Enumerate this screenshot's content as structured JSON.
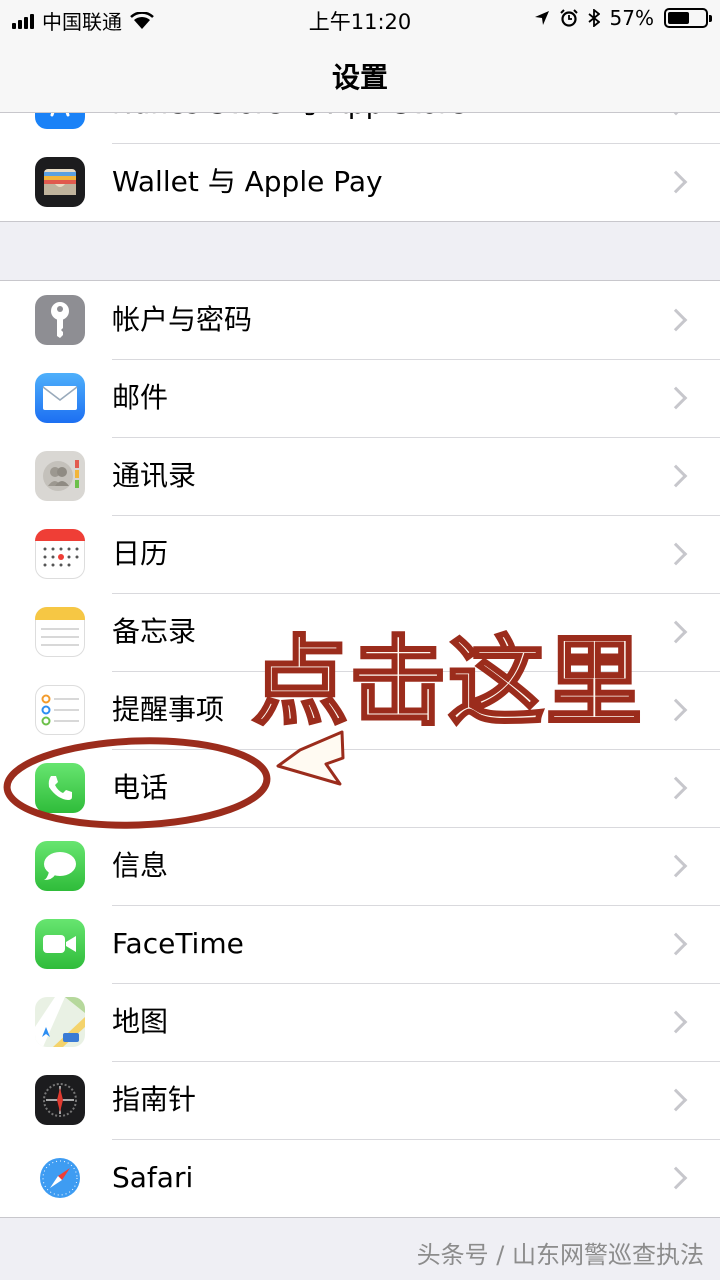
{
  "status_bar": {
    "carrier": "中国联通",
    "time": "上午11:20",
    "battery_percent": "57%",
    "battery_level": 0.57,
    "icons": [
      "signal-icon",
      "wifi-icon",
      "location-icon",
      "alarm-icon",
      "bluetooth-icon",
      "battery-icon"
    ]
  },
  "nav": {
    "title": "设置"
  },
  "groups": [
    {
      "items": [
        {
          "label": "iTunes Store 与 App Store",
          "icon": "app-store-icon",
          "color": "#1a82f7"
        },
        {
          "label": "Wallet 与 Apple Pay",
          "icon": "wallet-icon",
          "color": "#1c1c1e"
        }
      ]
    },
    {
      "items": [
        {
          "label": "帐户与密码",
          "icon": "key-icon",
          "color": "#8e8e93"
        },
        {
          "label": "邮件",
          "icon": "mail-icon",
          "color": "#2d8ef2"
        },
        {
          "label": "通讯录",
          "icon": "contacts-icon",
          "color": "#d9d7d3"
        },
        {
          "label": "日历",
          "icon": "calendar-icon",
          "color": "#ffffff"
        },
        {
          "label": "备忘录",
          "icon": "notes-icon",
          "color": "#ffffff"
        },
        {
          "label": "提醒事项",
          "icon": "reminders-icon",
          "color": "#ffffff"
        },
        {
          "label": "电话",
          "icon": "phone-icon",
          "color": "#4cd964"
        },
        {
          "label": "信息",
          "icon": "messages-icon",
          "color": "#4cd964"
        },
        {
          "label": "FaceTime",
          "icon": "facetime-icon",
          "color": "#4cd964"
        },
        {
          "label": "地图",
          "icon": "maps-icon",
          "color": "#e9f1e4"
        },
        {
          "label": "指南针",
          "icon": "compass-icon",
          "color": "#1c1c1e"
        },
        {
          "label": "Safari",
          "icon": "safari-icon",
          "color": "#ffffff"
        }
      ]
    }
  ],
  "annotation": {
    "text": "点击这里",
    "color": "#9b2c1c"
  },
  "watermark": "头条号 / 山东网警巡查执法"
}
